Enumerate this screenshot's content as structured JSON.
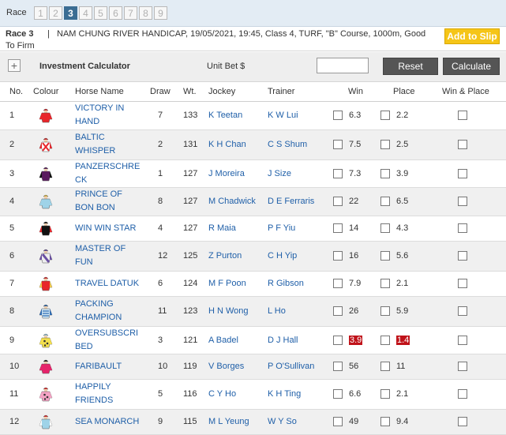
{
  "race_bar": {
    "label": "Race",
    "races": [
      "1",
      "2",
      "3",
      "4",
      "5",
      "6",
      "7",
      "8",
      "9"
    ],
    "active_index": 2
  },
  "race_info": {
    "race_no": "Race 3",
    "description": "NAM CHUNG RIVER HANDICAP, 19/05/2021, 19:45, Class 4, TURF, \"B\" Course, 1000m, Good",
    "description_cont": "To Firm",
    "add_slip_label": "Add to Slip"
  },
  "calculator": {
    "title": "Investment Calculator",
    "unit_bet_label": "Unit Bet $",
    "unit_bet_value": "",
    "reset_label": "Reset",
    "calculate_label": "Calculate"
  },
  "table": {
    "headers": [
      "No.",
      "Colour",
      "Horse Name",
      "Draw",
      "Wt.",
      "Jockey",
      "Trainer",
      "Win",
      "Place",
      "Win & Place"
    ],
    "rows": [
      {
        "no": "1",
        "horse": "VICTORY IN HAND",
        "draw": "7",
        "wt": "133",
        "jockey": "K Teetan",
        "trainer": "K W Lui",
        "win": "6.3",
        "place": "2.2",
        "win_hot": false,
        "place_hot": false,
        "silk": {
          "body": "#e8262b",
          "sleeve": "#e8262b",
          "cap": "#e8262b",
          "pattern": "none"
        }
      },
      {
        "no": "2",
        "horse": "BALTIC WHISPER",
        "draw": "2",
        "wt": "131",
        "jockey": "K H Chan",
        "trainer": "C S Shum",
        "win": "7.5",
        "place": "2.5",
        "win_hot": false,
        "place_hot": false,
        "silk": {
          "body": "#ffffff",
          "sleeve": "#e8262b",
          "cap": "#e8262b",
          "pattern": "cross"
        }
      },
      {
        "no": "3",
        "horse": "PANZERSCHRECK",
        "draw": "1",
        "wt": "127",
        "jockey": "J Moreira",
        "trainer": "J Size",
        "win": "7.3",
        "place": "3.9",
        "win_hot": false,
        "place_hot": false,
        "silk": {
          "body": "#5a1a5e",
          "sleeve": "#111111",
          "cap": "#5a1a5e",
          "pattern": "none"
        }
      },
      {
        "no": "4",
        "horse": "PRINCE OF BON BON",
        "draw": "8",
        "wt": "127",
        "jockey": "M Chadwick",
        "trainer": "D E Ferraris",
        "win": "22",
        "place": "6.5",
        "win_hot": false,
        "place_hot": false,
        "silk": {
          "body": "#9fd3e8",
          "sleeve": "#9fd3e8",
          "cap": "#f2c94c",
          "pattern": "none"
        }
      },
      {
        "no": "5",
        "horse": "WIN WIN STAR",
        "draw": "4",
        "wt": "127",
        "jockey": "R Maia",
        "trainer": "P F Yiu",
        "win": "14",
        "place": "4.3",
        "win_hot": false,
        "place_hot": false,
        "silk": {
          "body": "#111111",
          "sleeve": "#e8262b",
          "cap": "#111111",
          "pattern": "none"
        }
      },
      {
        "no": "6",
        "horse": "MASTER OF FUN",
        "draw": "12",
        "wt": "125",
        "jockey": "Z Purton",
        "trainer": "C H Yip",
        "win": "16",
        "place": "5.6",
        "win_hot": false,
        "place_hot": false,
        "silk": {
          "body": "#eeeeee",
          "sleeve": "#6a4fa3",
          "cap": "#6a4fa3",
          "pattern": "sash"
        }
      },
      {
        "no": "7",
        "horse": "TRAVEL DATUK",
        "draw": "6",
        "wt": "124",
        "jockey": "M F Poon",
        "trainer": "R Gibson",
        "win": "7.9",
        "place": "2.1",
        "win_hot": false,
        "place_hot": false,
        "silk": {
          "body": "#e8262b",
          "sleeve": "#f2c94c",
          "cap": "#e8262b",
          "pattern": "none"
        }
      },
      {
        "no": "8",
        "horse": "PACKING CHAMPION",
        "draw": "11",
        "wt": "123",
        "jockey": "H N Wong",
        "trainer": "L Ho",
        "win": "26",
        "place": "5.9",
        "win_hot": false,
        "place_hot": false,
        "silk": {
          "body": "#cfe5f2",
          "sleeve": "#2f6db5",
          "cap": "#2f6db5",
          "pattern": "stripes"
        }
      },
      {
        "no": "9",
        "horse": "OVERSUBSCRIBED",
        "draw": "3",
        "wt": "121",
        "jockey": "A Badel",
        "trainer": "D J Hall",
        "win": "3.9",
        "place": "1.4",
        "win_hot": true,
        "place_hot": true,
        "silk": {
          "body": "#f4e04d",
          "sleeve": "#f4e04d",
          "cap": "#9fd3e8",
          "pattern": "spots"
        }
      },
      {
        "no": "10",
        "horse": "FARIBAULT",
        "draw": "10",
        "wt": "119",
        "jockey": "V Borges",
        "trainer": "P O'Sullivan",
        "win": "56",
        "place": "11",
        "win_hot": false,
        "place_hot": false,
        "silk": {
          "body": "#e6246b",
          "sleeve": "#e6246b",
          "cap": "#111111",
          "pattern": "none"
        }
      },
      {
        "no": "11",
        "horse": "HAPPILY FRIENDS",
        "draw": "5",
        "wt": "116",
        "jockey": "C Y Ho",
        "trainer": "K H Ting",
        "win": "6.6",
        "place": "2.1",
        "win_hot": false,
        "place_hot": false,
        "silk": {
          "body": "#f4a3c4",
          "sleeve": "#f4a3c4",
          "cap": "#e8262b",
          "pattern": "spots"
        }
      },
      {
        "no": "12",
        "horse": "SEA MONARCH",
        "draw": "9",
        "wt": "115",
        "jockey": "M L Yeung",
        "trainer": "W Y So",
        "win": "49",
        "place": "9.4",
        "win_hot": false,
        "place_hot": false,
        "silk": {
          "body": "#9fd3e8",
          "sleeve": "#ffffff",
          "cap": "#e8262b",
          "pattern": "none"
        }
      }
    ]
  },
  "horse_name_lines": {
    "1": [
      "VICTORY IN",
      "HAND"
    ],
    "2": [
      "BALTIC",
      "WHISPER"
    ],
    "3": [
      "PANZERSCHRE",
      "CK"
    ],
    "4": [
      "PRINCE OF",
      "BON BON"
    ],
    "5": [
      "WIN WIN STAR"
    ],
    "6": [
      "MASTER OF",
      "FUN"
    ],
    "7": [
      "TRAVEL DATUK"
    ],
    "8": [
      "PACKING",
      "CHAMPION"
    ],
    "9": [
      "OVERSUBSCRI",
      "BED"
    ],
    "10": [
      "FARIBAULT"
    ],
    "11": [
      "HAPPILY",
      "FRIENDS"
    ],
    "12": [
      "SEA MONARCH"
    ]
  },
  "colors": {
    "race_bar_bg": "#e3ecf4",
    "active_race": "#3b6d93",
    "link_blue": "#1f5fa8",
    "hot_odds": "#c0131a",
    "add_slip": "#f5c518"
  }
}
